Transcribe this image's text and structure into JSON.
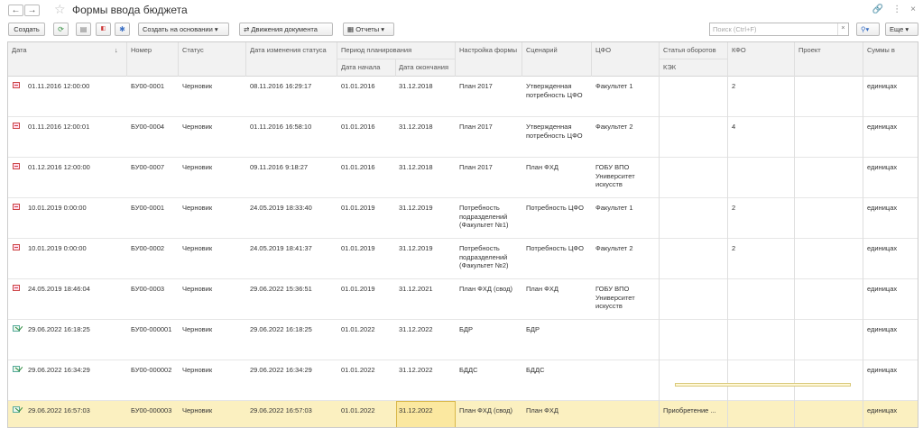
{
  "title": "Формы ввода бюджета",
  "toolbar": {
    "create": "Создать",
    "based_on": "Создать на основании",
    "movements": "Движения документа",
    "reports": "Отчеты",
    "search_placeholder": "Поиск (Ctrl+F)",
    "more": "Еще"
  },
  "columns": {
    "date": "Дата",
    "number": "Номер",
    "status": "Статус",
    "status_changed": "Дата изменения статуса",
    "period": "Период планирования",
    "period_start": "Дата начала",
    "period_end": "Дата окончания",
    "form_setting": "Настройка формы",
    "scenario": "Сценарий",
    "cfo": "ЦФО",
    "turnover_item": "Статья оборотов",
    "kek": "КЭК",
    "kfo": "КФО",
    "project": "Проект",
    "amounts_in": "Суммы в"
  },
  "rows": [
    {
      "icon": "red",
      "date": "01.11.2016 12:00:00",
      "number": "БУ00-0001",
      "status": "Черновик",
      "changed": "08.11.2016 16:29:17",
      "start": "01.01.2016",
      "end": "31.12.2018",
      "form": "План 2017",
      "scenario": "Утвержденная потребность ЦФО",
      "cfo": "Факультет 1",
      "item": "",
      "kfo": "2",
      "project": "",
      "amounts": "единицах"
    },
    {
      "icon": "red",
      "date": "01.11.2016 12:00:01",
      "number": "БУ00-0004",
      "status": "Черновик",
      "changed": "01.11.2016 16:58:10",
      "start": "01.01.2016",
      "end": "31.12.2018",
      "form": "План 2017",
      "scenario": "Утвержденная потребность ЦФО",
      "cfo": "Факультет 2",
      "item": "",
      "kfo": "4",
      "project": "",
      "amounts": "единицах"
    },
    {
      "icon": "red",
      "date": "01.12.2016 12:00:00",
      "number": "БУ00-0007",
      "status": "Черновик",
      "changed": "09.11.2016 9:18:27",
      "start": "01.01.2016",
      "end": "31.12.2018",
      "form": "План 2017",
      "scenario": "План ФХД",
      "cfo": "ГОБУ ВПО Университет искусств",
      "item": "",
      "kfo": "",
      "project": "",
      "amounts": "единицах"
    },
    {
      "icon": "red",
      "date": "10.01.2019 0:00:00",
      "number": "БУ00-0001",
      "status": "Черновик",
      "changed": "24.05.2019 18:33:40",
      "start": "01.01.2019",
      "end": "31.12.2019",
      "form": "Потребность подразделений (Факультет №1)",
      "scenario": "Потребность ЦФО",
      "cfo": "Факультет 1",
      "item": "",
      "kfo": "2",
      "project": "",
      "amounts": "единицах"
    },
    {
      "icon": "red",
      "date": "10.01.2019 0:00:00",
      "number": "БУ00-0002",
      "status": "Черновик",
      "changed": "24.05.2019 18:41:37",
      "start": "01.01.2019",
      "end": "31.12.2019",
      "form": "Потребность подразделений (Факультет №2)",
      "scenario": "Потребность ЦФО",
      "cfo": "Факультет 2",
      "item": "",
      "kfo": "2",
      "project": "",
      "amounts": "единицах"
    },
    {
      "icon": "red",
      "date": "24.05.2019 18:46:04",
      "number": "БУ00-0003",
      "status": "Черновик",
      "changed": "29.06.2022 15:36:51",
      "start": "01.01.2019",
      "end": "31.12.2021",
      "form": "План ФХД (свод)",
      "scenario": "План ФХД",
      "cfo": "ГОБУ ВПО Университет искусств",
      "item": "",
      "kfo": "",
      "project": "",
      "amounts": "единицах"
    },
    {
      "icon": "green",
      "date": "29.06.2022 16:18:25",
      "number": "БУ00-000001",
      "status": "Черновик",
      "changed": "29.06.2022 16:18:25",
      "start": "01.01.2022",
      "end": "31.12.2022",
      "form": "БДР",
      "scenario": "БДР",
      "cfo": "",
      "item": "",
      "kfo": "",
      "project": "",
      "amounts": "единицах"
    },
    {
      "icon": "green",
      "date": "29.06.2022 16:34:29",
      "number": "БУ00-000002",
      "status": "Черновик",
      "changed": "29.06.2022 16:34:29",
      "start": "01.01.2022",
      "end": "31.12.2022",
      "form": "БДДС",
      "scenario": "БДДС",
      "cfo": "",
      "item": "",
      "kfo": "",
      "project": "",
      "amounts": "единицах"
    },
    {
      "icon": "green",
      "date": "29.06.2022 16:57:03",
      "number": "БУ00-000003",
      "status": "Черновик",
      "changed": "29.06.2022 16:57:03",
      "start": "01.01.2022",
      "end": "31.12.2022",
      "form": "План ФХД (свод)",
      "scenario": "План ФХД",
      "cfo": "",
      "item": "Приобретение ...",
      "kfo": "",
      "project": "",
      "amounts": "единицах"
    }
  ],
  "selected_row": 8
}
